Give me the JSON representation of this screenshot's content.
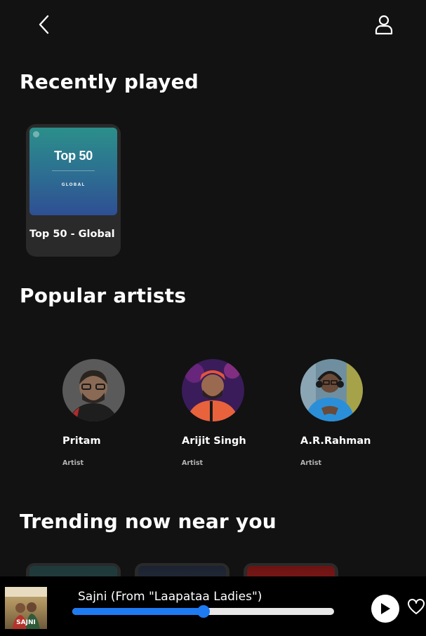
{
  "header": {
    "back_icon": "chevron-left-icon",
    "profile_icon": "user-icon"
  },
  "recently_played": {
    "title": "Recently played",
    "items": [
      {
        "name": "Top 50 - Global",
        "cover_title": "Top 50",
        "cover_subtitle": "GLOBAL"
      }
    ]
  },
  "popular_artists": {
    "title": "Popular artists",
    "items": [
      {
        "name": "Pritam",
        "role": "Artist"
      },
      {
        "name": "Arijit Singh",
        "role": "Artist"
      },
      {
        "name": "A.R.Rahman",
        "role": "Artist"
      }
    ]
  },
  "trending": {
    "title": "Trending now near you"
  },
  "player": {
    "track_title": "Sajni (From \"Laapataa Ladies\")",
    "artwork_label": "SAJNI",
    "progress": 0.5,
    "play_icon": "play-icon",
    "like_icon": "heart-icon",
    "accent_color": "#1e7bf2"
  }
}
